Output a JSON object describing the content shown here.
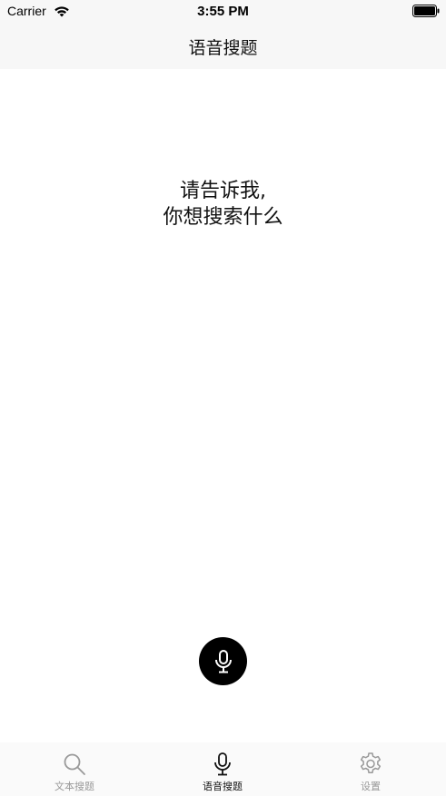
{
  "status_bar": {
    "carrier": "Carrier",
    "time": "3:55 PM",
    "wifi_icon": "wifi-icon",
    "battery_icon": "battery-icon"
  },
  "nav": {
    "title": "语音搜题"
  },
  "main": {
    "prompt_line1": "请告诉我,",
    "prompt_line2": "你想搜索什么",
    "mic_button_icon": "microphone-icon"
  },
  "tabs": [
    {
      "label": "文本搜题",
      "icon": "search-icon",
      "active": false
    },
    {
      "label": "语音搜题",
      "icon": "microphone-icon",
      "active": true
    },
    {
      "label": "设置",
      "icon": "gear-icon",
      "active": false
    }
  ],
  "colors": {
    "active_tab": "#111111",
    "inactive_tab": "#999999",
    "mic_button_bg": "#000000",
    "bar_bg": "#f7f7f7"
  }
}
